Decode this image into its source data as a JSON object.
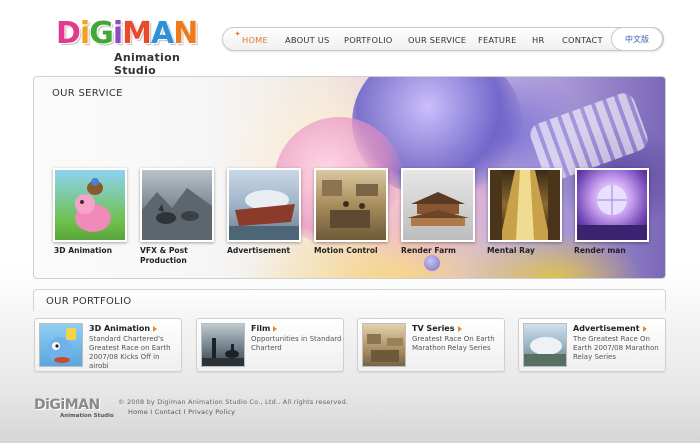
{
  "brand": {
    "logo_letters": [
      "D",
      "i",
      "G",
      "i",
      "M",
      "A",
      "N"
    ],
    "logo_colors": [
      "#e23a8c",
      "#f3a21b",
      "#41a835",
      "#8f4bc2",
      "#e94a2c",
      "#2f8fd8",
      "#f07a1a"
    ],
    "subtitle": "Animation Studio"
  },
  "nav": {
    "items": [
      {
        "label": "HOME",
        "active": true
      },
      {
        "label": "ABOUT US",
        "active": false
      },
      {
        "label": "PORTFOLIO",
        "active": false
      },
      {
        "label": "OUR SERVICE",
        "active": false
      },
      {
        "label": "FEATURE",
        "active": false
      },
      {
        "label": "HR",
        "active": false
      },
      {
        "label": "CONTACT",
        "active": false
      }
    ],
    "language": "中文版",
    "active_color": "#e7782a"
  },
  "service": {
    "title": "OUR SERVICE",
    "items": [
      {
        "label": "3D Animation",
        "icon": "cartoon-pig-image"
      },
      {
        "label": "VFX & Post Production",
        "icon": "wolves-image"
      },
      {
        "label": "Advertisement",
        "icon": "ship-image"
      },
      {
        "label": "Motion Control",
        "icon": "battle-scene-image"
      },
      {
        "label": "Render Farm",
        "icon": "palace-image"
      },
      {
        "label": "Mental Ray",
        "icon": "corridor-image"
      },
      {
        "label": "Render man",
        "icon": "disco-ball-image"
      }
    ]
  },
  "portfolio": {
    "title": "OUR PORTFOLIO",
    "items": [
      {
        "title": "3D Animation",
        "desc": "Standard Chartered's Greatest Race on Earth 2007/08 Kicks Off in airobi",
        "icon": "cartoon-character-image"
      },
      {
        "title": "Film",
        "desc": "Opportunities in Standard Charterd",
        "icon": "horse-rider-image"
      },
      {
        "title": "TV Series",
        "desc": "Greatest Race On Earth Marathon Relay Series",
        "icon": "ancient-city-image"
      },
      {
        "title": "Advertisement",
        "desc": "The Greatest Race On Earth 2007/08 Marathon Relay Series",
        "icon": "stadium-image"
      }
    ]
  },
  "footer": {
    "logo": "DiGiMAN",
    "logo_sub": "Animation Studio",
    "copyright": "© 2008 by Digiman Animation Studio Co., Ltd.. All rights reserved.",
    "links": [
      "Home",
      "Contact",
      "Privacy Policy"
    ],
    "separator": "I"
  }
}
